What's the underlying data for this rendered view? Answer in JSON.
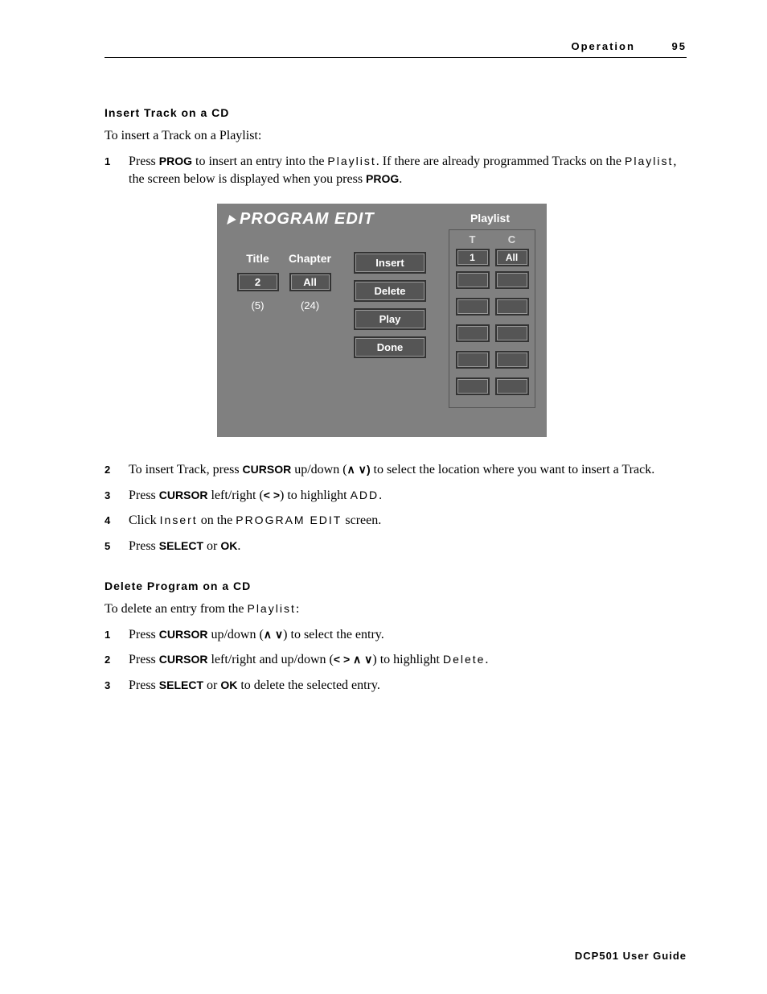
{
  "header": {
    "section": "Operation",
    "page": "95"
  },
  "footer": "DCP501 User Guide",
  "section1": {
    "title": "Insert Track on a CD",
    "intro": "To insert a Track on a Playlist:",
    "steps": [
      {
        "n": "1",
        "pre": "Press ",
        "b1": "PROG",
        "mid1": " to insert an entry into the ",
        "sp1": "Playlist",
        "mid2": ". If there are already programmed Tracks on the ",
        "sp2": "Playlist",
        "mid3": ", the screen below is displayed when you press ",
        "b2": "PROG",
        "post": "."
      },
      {
        "n": "2",
        "pre": "To insert Track, press ",
        "b1": "CURSOR",
        "mid1": " up/down (",
        "sym": "∧ ∨",
        "mid2": ") ",
        "post": "to select the location where you want to insert a Track."
      },
      {
        "n": "3",
        "pre": "Press ",
        "b1": "CURSOR",
        "mid1": " left/right (",
        "sym": "< >",
        "mid2": ") to highlight ",
        "sp1": "ADD",
        "post": "."
      },
      {
        "n": "4",
        "pre": "Click ",
        "sp1": "Insert",
        "mid1": " on the ",
        "sp2": "PROGRAM EDIT",
        "post": " screen."
      },
      {
        "n": "5",
        "pre": "Press ",
        "b1": "SELECT",
        "mid1": " or ",
        "b2": "OK",
        "post": "."
      }
    ]
  },
  "section2": {
    "title": "Delete Program on a CD",
    "intro_pre": "To delete an entry from the ",
    "intro_sp": "Playlist",
    "intro_post": ":",
    "steps": [
      {
        "n": "1",
        "pre": "Press ",
        "b1": "CURSOR",
        "mid1": " up/down (",
        "sym": "∧ ∨",
        "post": ") to select the entry."
      },
      {
        "n": "2",
        "pre": "Press ",
        "b1": "CURSOR",
        "mid1": " left/right and up/down (",
        "sym": "< > ∧ ∨",
        "mid2": ") to highlight ",
        "sp1": "Delete",
        "post": "."
      },
      {
        "n": "3",
        "pre": "Press ",
        "b1": "SELECT",
        "mid1": " or ",
        "b2": "OK",
        "post": " to delete the selected entry."
      }
    ]
  },
  "screen": {
    "title": "PROGRAM EDIT",
    "playlist_label": "Playlist",
    "left": {
      "col1": "Title",
      "col2": "Chapter",
      "val1": "2",
      "val2": "All",
      "p1": "(5)",
      "p2": "(24)"
    },
    "buttons": [
      "Insert",
      "Delete",
      "Play",
      "Done"
    ],
    "playlist": {
      "h1": "T",
      "h2": "C",
      "rows": [
        {
          "t": "1",
          "c": "All"
        },
        {
          "t": "",
          "c": ""
        },
        {
          "t": "",
          "c": ""
        },
        {
          "t": "",
          "c": ""
        },
        {
          "t": "",
          "c": ""
        },
        {
          "t": "",
          "c": ""
        }
      ]
    }
  }
}
